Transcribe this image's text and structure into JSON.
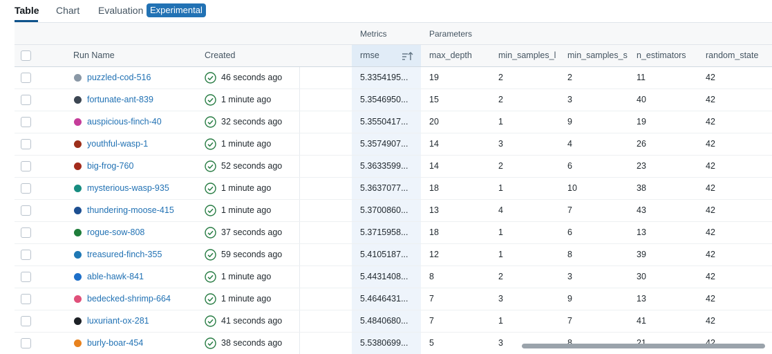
{
  "tabs": [
    {
      "label": "Table",
      "active": true
    },
    {
      "label": "Chart",
      "active": false
    },
    {
      "label": "Evaluation",
      "active": false
    }
  ],
  "badge": "Experimental",
  "groups": {
    "metrics": "Metrics",
    "parameters": "Parameters"
  },
  "columns": {
    "run_name": "Run Name",
    "created": "Created",
    "rmse": "rmse",
    "max_depth": "max_depth",
    "min_samples_leaf": "min_samples_l",
    "min_samples_split": "min_samples_s",
    "n_estimators": "n_estimators",
    "random_state": "random_state"
  },
  "colors": {
    "accent": "#2272b4",
    "success": "#277c43",
    "link": "#2272b4"
  },
  "rows": [
    {
      "name": "puzzled-cod-516",
      "color": "#8a98a6",
      "created": "46 seconds ago",
      "rmse": "5.3354195...",
      "max_depth": "19",
      "min_samples_leaf": "2",
      "min_samples_split": "2",
      "n_estimators": "11",
      "random_state": "42"
    },
    {
      "name": "fortunate-ant-839",
      "color": "#3c4652",
      "created": "1 minute ago",
      "rmse": "5.3546950...",
      "max_depth": "15",
      "min_samples_leaf": "2",
      "min_samples_split": "3",
      "n_estimators": "40",
      "random_state": "42"
    },
    {
      "name": "auspicious-finch-40",
      "color": "#c53d9a",
      "created": "32 seconds ago",
      "rmse": "5.3550417...",
      "max_depth": "20",
      "min_samples_leaf": "1",
      "min_samples_split": "9",
      "n_estimators": "19",
      "random_state": "42"
    },
    {
      "name": "youthful-wasp-1",
      "color": "#9c2f1a",
      "created": "1 minute ago",
      "rmse": "5.3574907...",
      "max_depth": "14",
      "min_samples_leaf": "3",
      "min_samples_split": "4",
      "n_estimators": "26",
      "random_state": "42"
    },
    {
      "name": "big-frog-760",
      "color": "#a32b1c",
      "created": "52 seconds ago",
      "rmse": "5.3633599...",
      "max_depth": "14",
      "min_samples_leaf": "2",
      "min_samples_split": "6",
      "n_estimators": "23",
      "random_state": "42"
    },
    {
      "name": "mysterious-wasp-935",
      "color": "#178c80",
      "created": "1 minute ago",
      "rmse": "5.3637077...",
      "max_depth": "18",
      "min_samples_leaf": "1",
      "min_samples_split": "10",
      "n_estimators": "38",
      "random_state": "42"
    },
    {
      "name": "thundering-moose-415",
      "color": "#1d4f91",
      "created": "1 minute ago",
      "rmse": "5.3700860...",
      "max_depth": "13",
      "min_samples_leaf": "4",
      "min_samples_split": "7",
      "n_estimators": "43",
      "random_state": "42"
    },
    {
      "name": "rogue-sow-808",
      "color": "#1f7d3b",
      "created": "37 seconds ago",
      "rmse": "5.3715958...",
      "max_depth": "18",
      "min_samples_leaf": "1",
      "min_samples_split": "6",
      "n_estimators": "13",
      "random_state": "42"
    },
    {
      "name": "treasured-finch-355",
      "color": "#1f78b4",
      "created": "59 seconds ago",
      "rmse": "5.4105187...",
      "max_depth": "12",
      "min_samples_leaf": "1",
      "min_samples_split": "8",
      "n_estimators": "39",
      "random_state": "42"
    },
    {
      "name": "able-hawk-841",
      "color": "#1d6fc9",
      "created": "1 minute ago",
      "rmse": "5.4431408...",
      "max_depth": "8",
      "min_samples_leaf": "2",
      "min_samples_split": "3",
      "n_estimators": "30",
      "random_state": "42"
    },
    {
      "name": "bedecked-shrimp-664",
      "color": "#e0507a",
      "created": "1 minute ago",
      "rmse": "5.4646431...",
      "max_depth": "7",
      "min_samples_leaf": "3",
      "min_samples_split": "9",
      "n_estimators": "13",
      "random_state": "42"
    },
    {
      "name": "luxuriant-ox-281",
      "color": "#1d2126",
      "created": "41 seconds ago",
      "rmse": "5.4840680...",
      "max_depth": "7",
      "min_samples_leaf": "1",
      "min_samples_split": "7",
      "n_estimators": "41",
      "random_state": "42"
    },
    {
      "name": "burly-boar-454",
      "color": "#e8821e",
      "created": "38 seconds ago",
      "rmse": "5.5380699...",
      "max_depth": "5",
      "min_samples_leaf": "3",
      "min_samples_split": "8",
      "n_estimators": "21",
      "random_state": "42"
    }
  ]
}
